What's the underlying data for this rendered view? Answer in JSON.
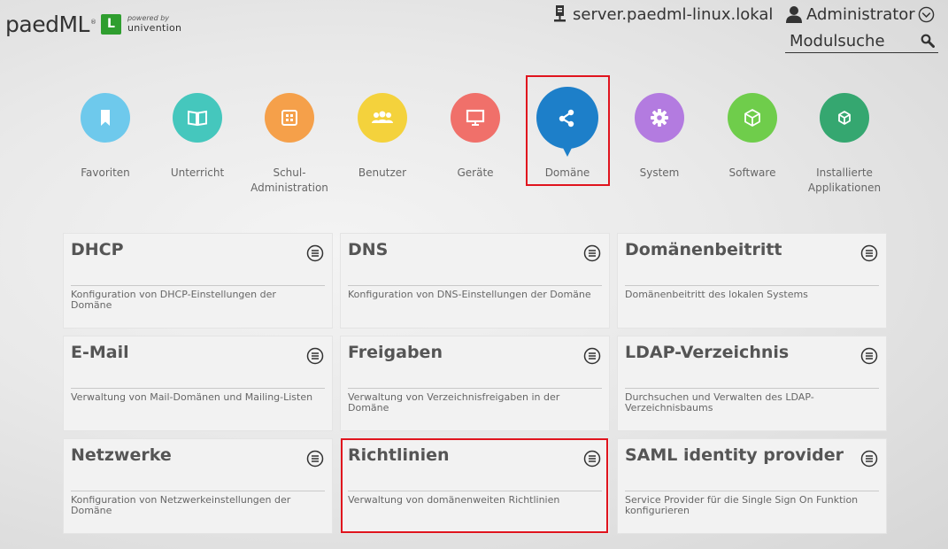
{
  "header": {
    "logo": {
      "name": "paedML",
      "badge": "L",
      "powered_by": "powered by",
      "vendor": "univention"
    },
    "server": "server.paedml-linux.lokal",
    "user": "Administrator",
    "search_placeholder": "Modulsuche"
  },
  "categories": [
    {
      "label": "Favoriten",
      "icon": "bookmark-icon",
      "color": "#6ec9ec"
    },
    {
      "label": "Unterricht",
      "icon": "open-book-icon",
      "color": "#45c7bd"
    },
    {
      "label": "Schul-\nAdministration",
      "icon": "school-admin-icon",
      "color": "#f5a04a"
    },
    {
      "label": "Benutzer",
      "icon": "users-icon",
      "color": "#f4d23c"
    },
    {
      "label": "Geräte",
      "icon": "monitor-icon",
      "color": "#f0706a"
    },
    {
      "label": "Domäne",
      "icon": "share-icon",
      "color": "#1d7fc9",
      "active": true
    },
    {
      "label": "System",
      "icon": "gear-icon",
      "color": "#b37be0"
    },
    {
      "label": "Software",
      "icon": "package-icon",
      "color": "#6fcd4b"
    },
    {
      "label": "Installierte\nApplikationen",
      "icon": "installed-apps-icon",
      "color": "#35a770"
    }
  ],
  "modules": [
    {
      "title": "DHCP",
      "desc": "Konfiguration von DHCP-Einstellungen der Domäne"
    },
    {
      "title": "DNS",
      "desc": "Konfiguration von DNS-Einstellungen der Domäne"
    },
    {
      "title": "Domänenbeitritt",
      "desc": "Domänenbeitritt des lokalen Systems"
    },
    {
      "title": "E-Mail",
      "desc": "Verwaltung von Mail-Domänen und Mailing-Listen"
    },
    {
      "title": "Freigaben",
      "desc": "Verwaltung von Verzeichnisfreigaben in der Domäne"
    },
    {
      "title": "LDAP-Verzeichnis",
      "desc": "Durchsuchen und Verwalten des LDAP-Verzeichnisbaums"
    },
    {
      "title": "Netzwerke",
      "desc": "Konfiguration von Netzwerkeinstellungen der Domäne"
    },
    {
      "title": "Richtlinien",
      "desc": "Verwaltung von domänenweiten Richtlinien"
    },
    {
      "title": "SAML identity provider",
      "desc": "Service Provider für die Single Sign On Funktion konfigurieren"
    }
  ],
  "colors": {
    "highlight": "#e0141e",
    "tile_bg": "#f2f2f2"
  }
}
